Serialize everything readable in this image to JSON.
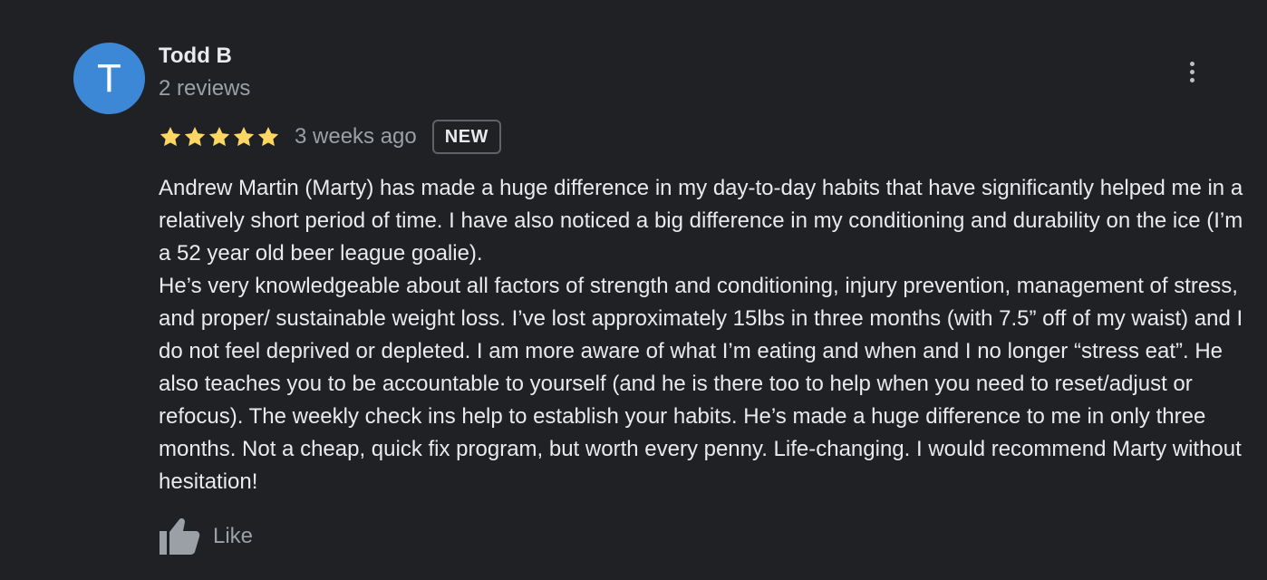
{
  "review": {
    "author": {
      "initial": "T",
      "name": "Todd B",
      "meta": "2 reviews",
      "avatar_color": "#3d88d6"
    },
    "rating": 5,
    "max_rating": 5,
    "star_color": "#fdd663",
    "timestamp": "3 weeks ago",
    "badge": "NEW",
    "text": "Andrew Martin (Marty) has made a huge difference in my day-to-day habits that have significantly helped me in a relatively short period of time. I have also noticed a big difference in my conditioning and durability on the ice (I’m a 52 year old beer league goalie).\nHe’s very knowledgeable about all factors of strength and conditioning, injury prevention, management of stress, and proper/ sustainable weight loss. I’ve lost approximately 15lbs in three months (with 7.5” off of my waist) and I do not feel deprived or depleted. I am more aware of what I’m eating and when and I no longer “stress eat”. He also teaches you to be accountable to yourself (and he is there too to help when you need to reset/adjust or refocus). The weekly check ins help to establish your habits. He’s made a huge difference to me in only three months. Not a cheap, quick fix program, but worth every penny. Life-changing. I would recommend Marty without hesitation!",
    "actions": {
      "like_label": "Like",
      "like_icon": "thumbs-up-icon",
      "more_icon": "more-vert-icon"
    }
  },
  "colors": {
    "background": "#202124",
    "primary_text": "#e8eaed",
    "secondary_text": "#9aa0a6"
  }
}
